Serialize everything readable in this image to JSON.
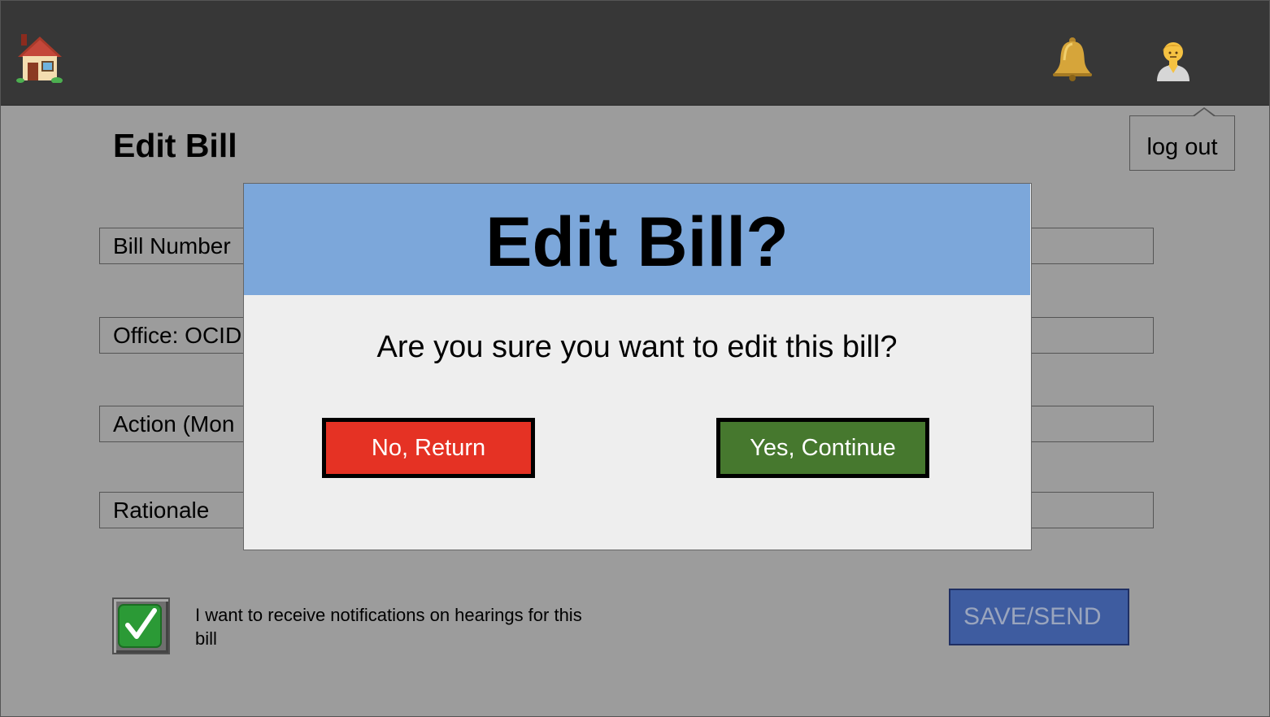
{
  "header": {
    "home_icon": "house-icon",
    "bell_icon": "bell-icon",
    "avatar_icon": "person-icon"
  },
  "page": {
    "title": "Edit Bill",
    "logout_label": "log out"
  },
  "fields": [
    {
      "label": "Bill Number"
    },
    {
      "label": "Office: OCID"
    },
    {
      "label": "Action (Mon"
    },
    {
      "label": "Rationale"
    }
  ],
  "notifications": {
    "checked": true,
    "label": "I want to receive notifications on hearings for this bill"
  },
  "save_button": {
    "label": "SAVE/SEND"
  },
  "modal": {
    "title": "Edit Bill?",
    "question": "Are you sure you want to edit this bill?",
    "no_label": "No, Return",
    "yes_label": "Yes, Continue"
  },
  "colors": {
    "topbar": "#373737",
    "page_bg": "#9c9c9c",
    "modal_header": "#7ca7da",
    "no_button": "#e53224",
    "yes_button": "#46782e",
    "save_button": "#3e5ca0"
  }
}
